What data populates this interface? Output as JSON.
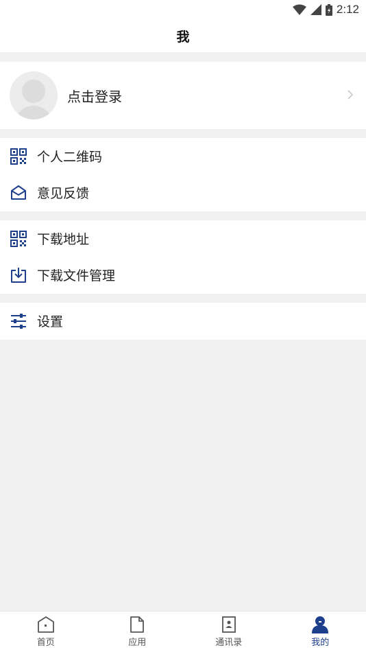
{
  "status_bar": {
    "time": "2:12"
  },
  "header": {
    "title": "我"
  },
  "profile": {
    "login_label": "点击登录"
  },
  "menu": {
    "group1": [
      {
        "label": "个人二维码",
        "icon": "qr-code-icon"
      },
      {
        "label": "意见反馈",
        "icon": "envelope-icon"
      }
    ],
    "group2": [
      {
        "label": "下载地址",
        "icon": "qr-code-icon"
      },
      {
        "label": "下载文件管理",
        "icon": "download-icon"
      }
    ],
    "group3": [
      {
        "label": "设置",
        "icon": "sliders-icon"
      }
    ]
  },
  "bottom_nav": {
    "tabs": [
      {
        "label": "首页",
        "icon": "home-icon"
      },
      {
        "label": "应用",
        "icon": "file-icon"
      },
      {
        "label": "通讯录",
        "icon": "contacts-icon"
      },
      {
        "label": "我的",
        "icon": "user-icon",
        "active": true
      }
    ]
  },
  "colors": {
    "accent": "#1e3f8c",
    "background": "#f1f1f1"
  }
}
